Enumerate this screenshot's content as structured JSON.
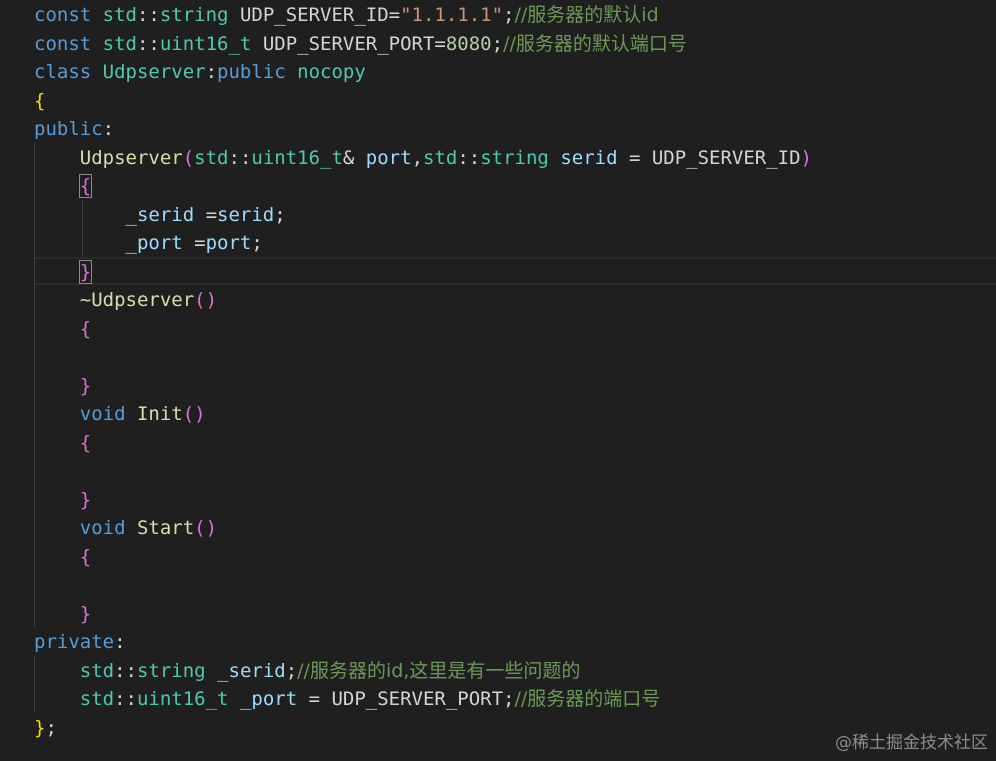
{
  "lines": [
    [
      {
        "t": "const",
        "c": "kw"
      },
      {
        "t": " std",
        "c": "ty"
      },
      {
        "t": "::",
        "c": ""
      },
      {
        "t": "string",
        "c": "ty"
      },
      {
        "t": " UDP_SERVER_ID=",
        "c": ""
      },
      {
        "t": "\"1.1.1.1\"",
        "c": "str"
      },
      {
        "t": ";",
        "c": ""
      },
      {
        "t": "//服务器的默认id",
        "c": "cm"
      }
    ],
    [
      {
        "t": "const",
        "c": "kw"
      },
      {
        "t": " std",
        "c": "ty"
      },
      {
        "t": "::",
        "c": ""
      },
      {
        "t": "uint16_t",
        "c": "ty"
      },
      {
        "t": " UDP_SERVER_PORT=",
        "c": ""
      },
      {
        "t": "8080",
        "c": "num"
      },
      {
        "t": ";",
        "c": ""
      },
      {
        "t": "//服务器的默认端口号",
        "c": "cm"
      }
    ],
    [
      {
        "t": "class",
        "c": "kw"
      },
      {
        "t": " Udpserver",
        "c": "ty"
      },
      {
        "t": ":",
        "c": ""
      },
      {
        "t": "public",
        "c": "kw"
      },
      {
        "t": " nocopy",
        "c": "ty"
      }
    ],
    [
      {
        "t": "{",
        "c": "b1"
      }
    ],
    [
      {
        "t": "public",
        "c": "kw"
      },
      {
        "t": ":",
        "c": ""
      }
    ],
    [
      {
        "t": "    ",
        "c": ""
      },
      {
        "t": "Udpserver",
        "c": "fn"
      },
      {
        "t": "(",
        "c": "b2"
      },
      {
        "t": "std",
        "c": "ty"
      },
      {
        "t": "::",
        "c": ""
      },
      {
        "t": "uint16_t",
        "c": "ty"
      },
      {
        "t": "& ",
        "c": ""
      },
      {
        "t": "port",
        "c": "var"
      },
      {
        "t": ",",
        "c": ""
      },
      {
        "t": "std",
        "c": "ty"
      },
      {
        "t": "::",
        "c": ""
      },
      {
        "t": "string",
        "c": "ty"
      },
      {
        "t": " serid",
        "c": "var"
      },
      {
        "t": " = UDP_SERVER_ID",
        "c": ""
      },
      {
        "t": ")",
        "c": "b2"
      }
    ],
    [
      {
        "t": "    ",
        "c": ""
      },
      {
        "t": "{",
        "c": "b2hl"
      }
    ],
    [
      {
        "t": "        ",
        "c": ""
      },
      {
        "t": "_serid",
        "c": "var"
      },
      {
        "t": " =",
        "c": ""
      },
      {
        "t": "serid",
        "c": "var"
      },
      {
        "t": ";",
        "c": ""
      }
    ],
    [
      {
        "t": "        ",
        "c": ""
      },
      {
        "t": "_port",
        "c": "var"
      },
      {
        "t": " =",
        "c": ""
      },
      {
        "t": "port",
        "c": "var"
      },
      {
        "t": ";",
        "c": ""
      }
    ],
    [
      {
        "t": "    ",
        "c": ""
      },
      {
        "t": "}",
        "c": "b2hl"
      }
    ],
    [
      {
        "t": "    ",
        "c": ""
      },
      {
        "t": "~Udpserver",
        "c": "fn"
      },
      {
        "t": "()",
        "c": "b2"
      }
    ],
    [
      {
        "t": "    ",
        "c": ""
      },
      {
        "t": "{",
        "c": "b2"
      }
    ],
    [
      {
        "t": "",
        "c": ""
      }
    ],
    [
      {
        "t": "    ",
        "c": ""
      },
      {
        "t": "}",
        "c": "b2"
      }
    ],
    [
      {
        "t": "    ",
        "c": ""
      },
      {
        "t": "void",
        "c": "kw"
      },
      {
        "t": " Init",
        "c": "fn"
      },
      {
        "t": "()",
        "c": "b2"
      }
    ],
    [
      {
        "t": "    ",
        "c": ""
      },
      {
        "t": "{",
        "c": "b2"
      }
    ],
    [
      {
        "t": "",
        "c": ""
      }
    ],
    [
      {
        "t": "    ",
        "c": ""
      },
      {
        "t": "}",
        "c": "b2"
      }
    ],
    [
      {
        "t": "    ",
        "c": ""
      },
      {
        "t": "void",
        "c": "kw"
      },
      {
        "t": " Start",
        "c": "fn"
      },
      {
        "t": "()",
        "c": "b2"
      }
    ],
    [
      {
        "t": "    ",
        "c": ""
      },
      {
        "t": "{",
        "c": "b2"
      }
    ],
    [
      {
        "t": "",
        "c": ""
      }
    ],
    [
      {
        "t": "    ",
        "c": ""
      },
      {
        "t": "}",
        "c": "b2"
      }
    ],
    [
      {
        "t": "private",
        "c": "kw"
      },
      {
        "t": ":",
        "c": ""
      }
    ],
    [
      {
        "t": "    ",
        "c": ""
      },
      {
        "t": "std",
        "c": "ty"
      },
      {
        "t": "::",
        "c": ""
      },
      {
        "t": "string",
        "c": "ty"
      },
      {
        "t": " _serid",
        "c": "var"
      },
      {
        "t": ";",
        "c": ""
      },
      {
        "t": "//服务器的id,这里是有一些问题的",
        "c": "cm"
      }
    ],
    [
      {
        "t": "    ",
        "c": ""
      },
      {
        "t": "std",
        "c": "ty"
      },
      {
        "t": "::",
        "c": ""
      },
      {
        "t": "uint16_t",
        "c": "ty"
      },
      {
        "t": " _port",
        "c": "var"
      },
      {
        "t": " = UDP_SERVER_PORT;",
        "c": ""
      },
      {
        "t": "//服务器的端口号",
        "c": "cm"
      }
    ],
    [
      {
        "t": "}",
        "c": "b1"
      },
      {
        "t": ";",
        "c": ""
      }
    ]
  ],
  "watermark": "@稀土掘金技术社区"
}
